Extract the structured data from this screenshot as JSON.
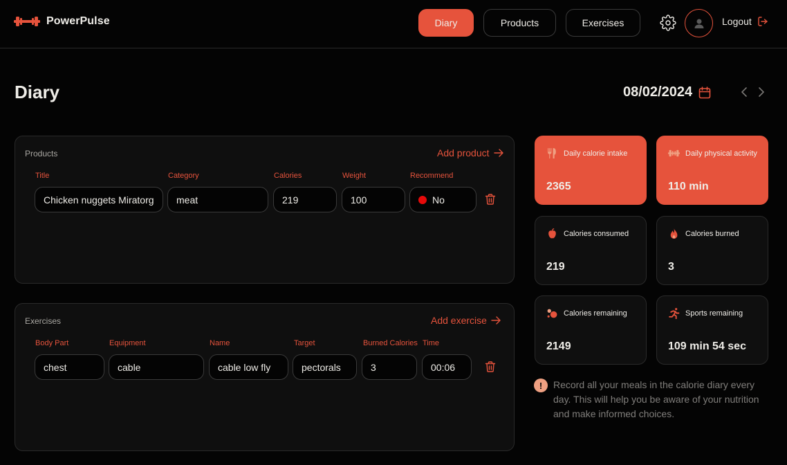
{
  "app": {
    "name": "PowerPulse"
  },
  "nav": {
    "diary": "Diary",
    "products": "Products",
    "exercises": "Exercises",
    "logout": "Logout"
  },
  "page": {
    "title": "Diary",
    "date": "08/02/2024"
  },
  "colors": {
    "accent": "#e6533c",
    "background": "#040404",
    "panel": "#0f0f0f",
    "not_recommended": "#e60a0a"
  },
  "products": {
    "title": "Products",
    "add_label": "Add product",
    "columns": [
      "Title",
      "Category",
      "Calories",
      "Weight",
      "Recommend"
    ],
    "rows": [
      {
        "title": "Chicken nuggets Miratorg",
        "category": "meat",
        "calories": "219",
        "weight": "100",
        "recommend": "No"
      }
    ]
  },
  "exercises": {
    "title": "Exercises",
    "add_label": "Add exercise",
    "columns": [
      "Body Part",
      "Equipment",
      "Name",
      "Target",
      "Burned Calories",
      "Time"
    ],
    "rows": [
      {
        "body_part": "chest",
        "equipment": "cable",
        "name": "cable low fly",
        "target": "pectorals",
        "burned_calories": "3",
        "time": "00:06"
      }
    ]
  },
  "stats": [
    {
      "label": "Daily calorie intake",
      "value": "2365",
      "icon": "fork-knife-icon"
    },
    {
      "label": "Daily physical activity",
      "value": "110 min",
      "icon": "dumbbell-icon"
    },
    {
      "label": "Calories consumed",
      "value": "219",
      "icon": "apple-icon"
    },
    {
      "label": "Calories burned",
      "value": "3",
      "icon": "flame-icon"
    },
    {
      "label": "Calories remaining",
      "value": "2149",
      "icon": "bubbles-icon"
    },
    {
      "label": "Sports remaining",
      "value": "109 min 54 sec",
      "icon": "runner-icon"
    }
  ],
  "tip": {
    "icon": "!",
    "text": "Record all your meals in the calorie diary every day. This will help you be aware of your nutrition and make informed choices."
  }
}
